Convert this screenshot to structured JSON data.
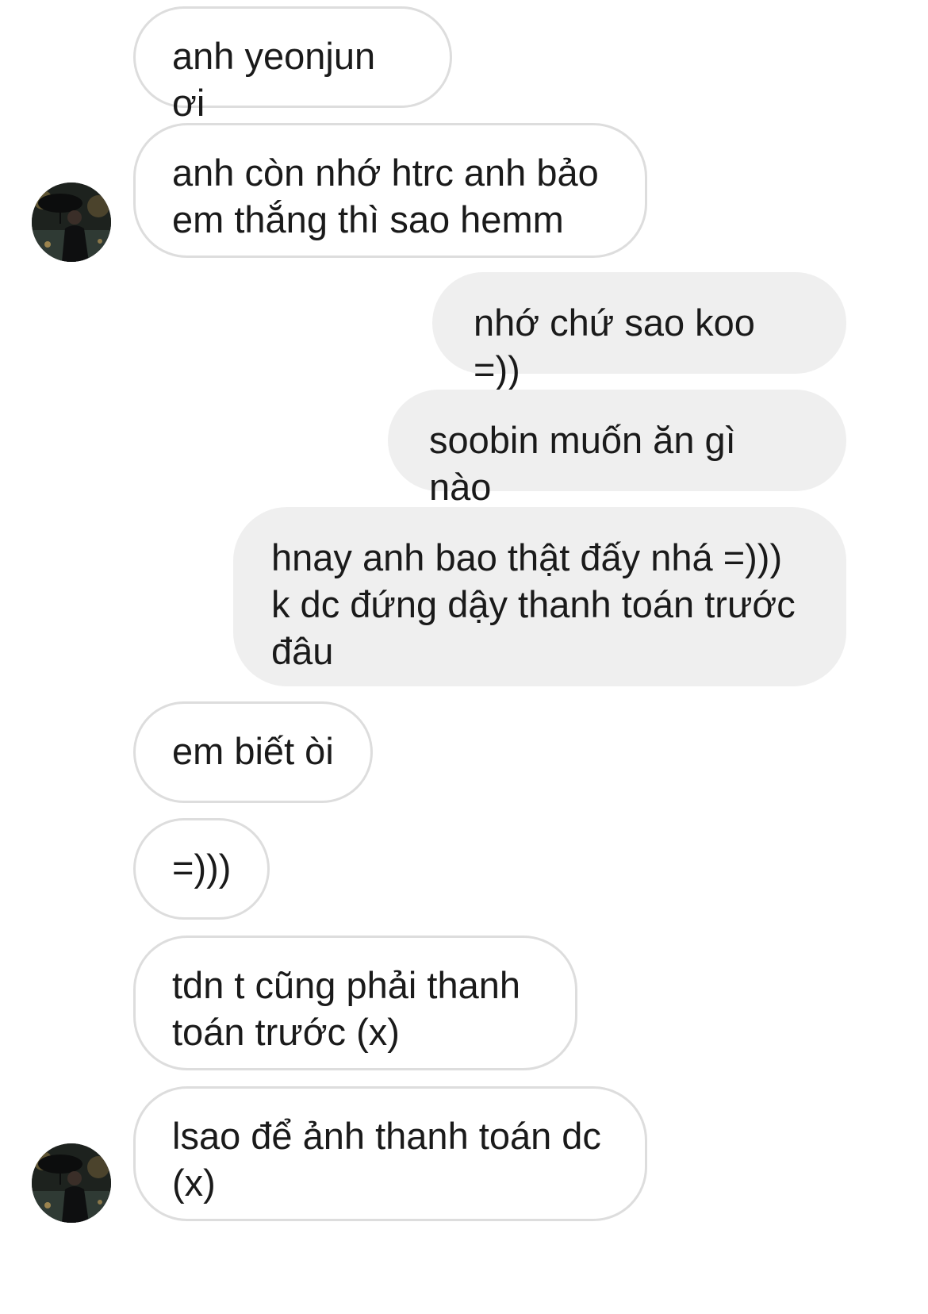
{
  "conversation": {
    "messages": [
      {
        "id": "m1",
        "sender": "other",
        "text": "anh yeonjun ơi"
      },
      {
        "id": "m2",
        "sender": "other",
        "text": "anh còn nhớ htrc anh bảo\nem thắng thì sao hemm"
      },
      {
        "id": "m3",
        "sender": "me",
        "text": "nhớ chứ sao koo =))"
      },
      {
        "id": "m4",
        "sender": "me",
        "text": "soobin muốn ăn gì nào"
      },
      {
        "id": "m5",
        "sender": "me",
        "text": "hnay anh bao thật đấy nhá =)))\nk dc đứng dậy thanh toán trước\nđâu"
      },
      {
        "id": "m6",
        "sender": "other",
        "text": "em biết òi"
      },
      {
        "id": "m7",
        "sender": "other",
        "text": "=)))"
      },
      {
        "id": "m8",
        "sender": "other",
        "text": "tdn t cũng phải thanh\ntoán trước (x)"
      },
      {
        "id": "m9",
        "sender": "other",
        "text": "lsao để ảnh thanh toán dc\n(x)"
      }
    ]
  },
  "colors": {
    "incoming_bubble_bg": "#ffffff",
    "incoming_bubble_border": "#dddddd",
    "outgoing_bubble_bg": "#efefef",
    "text": "#1a1a1a"
  }
}
